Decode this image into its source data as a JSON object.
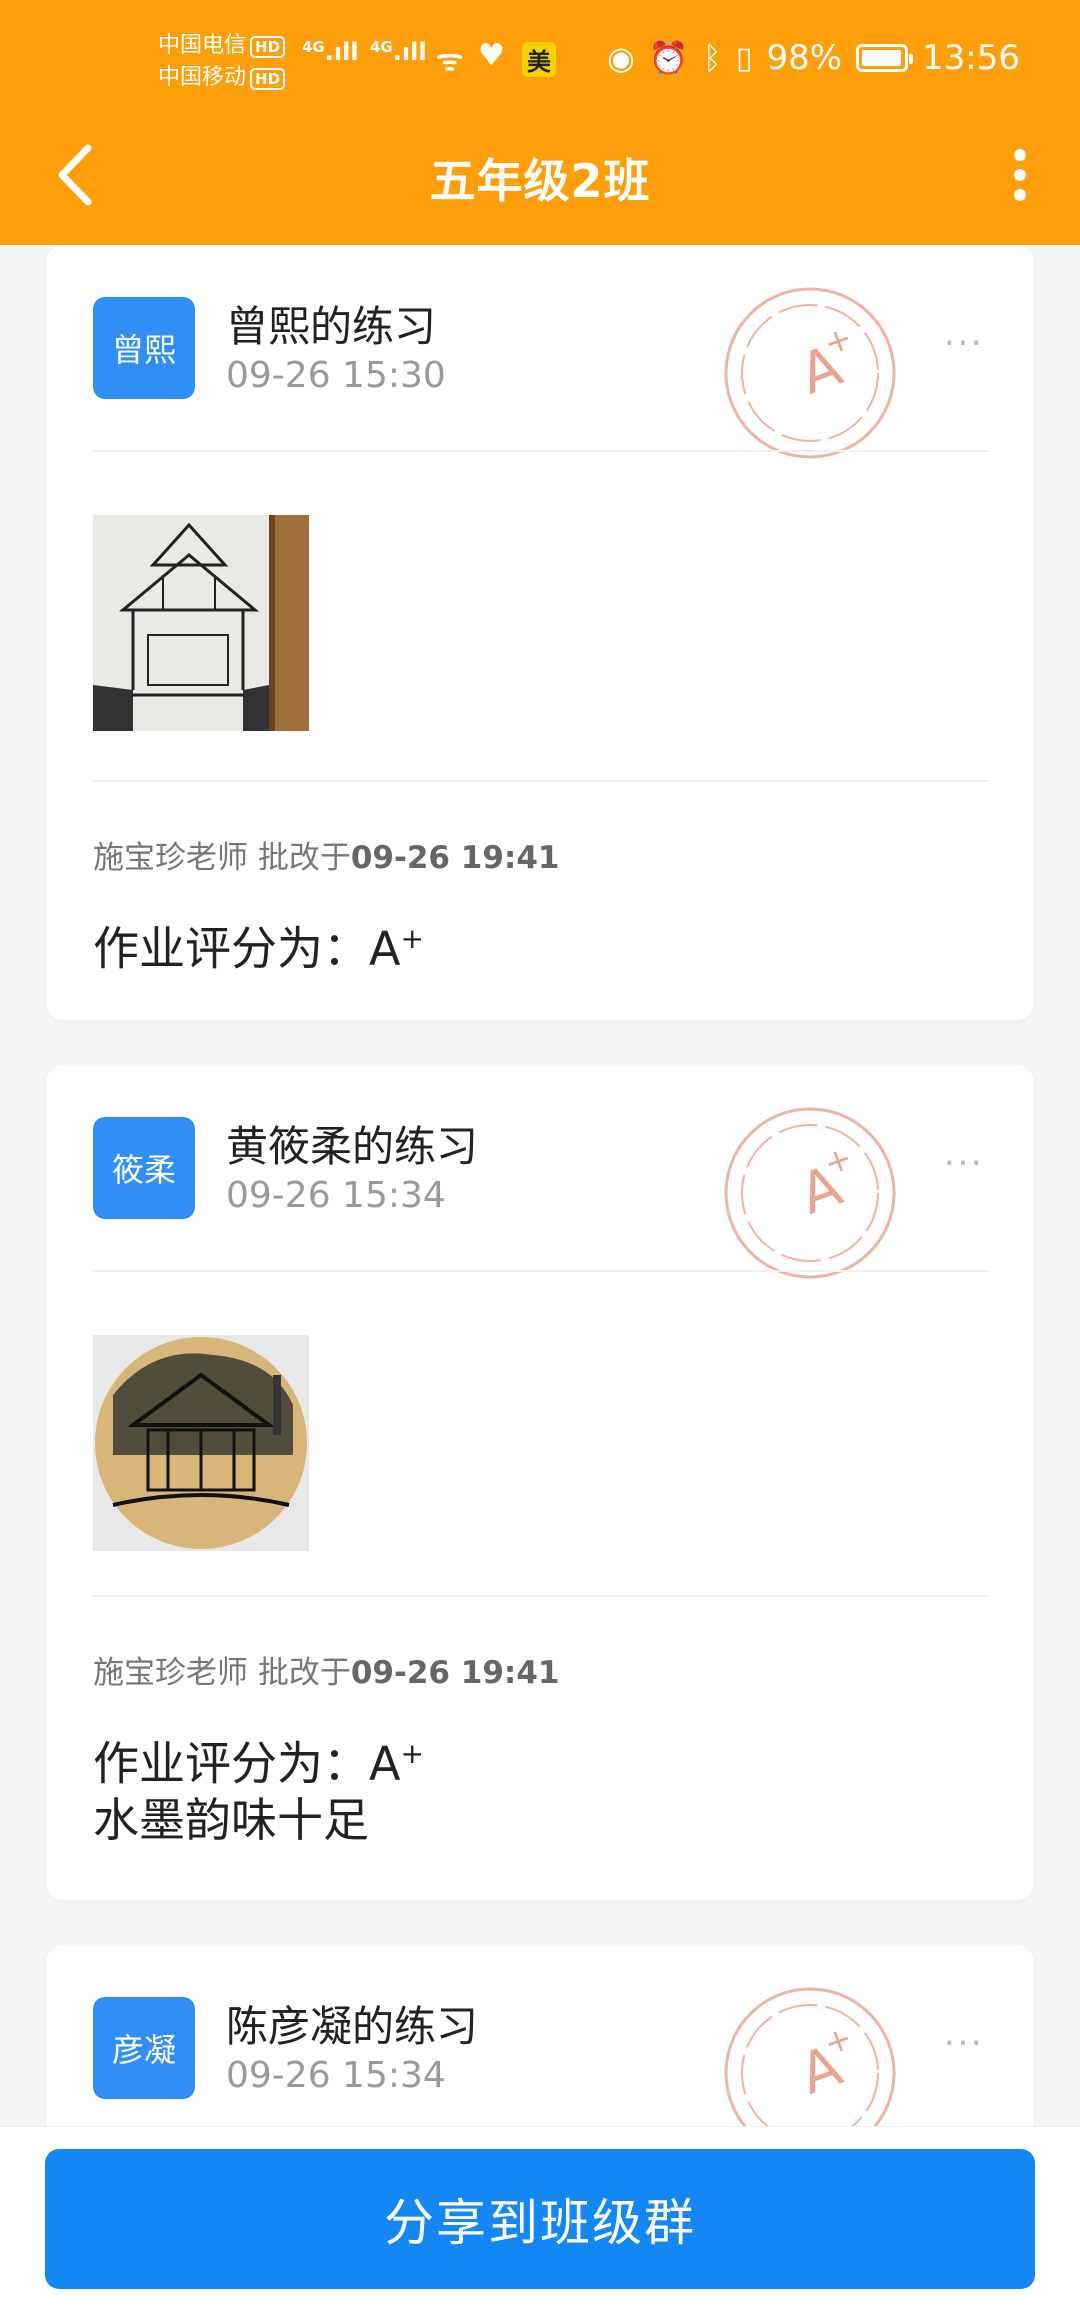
{
  "status": {
    "carrier1": "中国电信",
    "carrier2": "中国移动",
    "hd": "HD",
    "net": "4G",
    "app_badge": "美",
    "battery_text": "98%",
    "battery_level": 0.98,
    "time": "13:56"
  },
  "header": {
    "title": "五年级2班"
  },
  "cards": [
    {
      "avatar": "曾熙",
      "name": "曾熙的练习",
      "time": "09-26 15:30",
      "teacher": "施宝珍老师 批改于",
      "graded_time": "09-26 19:41",
      "score_label": "作业评分为：",
      "score": "A",
      "score_sup": "+",
      "comment": ""
    },
    {
      "avatar": "筱柔",
      "name": "黄筱柔的练习",
      "time": "09-26 15:34",
      "teacher": "施宝珍老师 批改于",
      "graded_time": "09-26 19:41",
      "score_label": "作业评分为：",
      "score": "A",
      "score_sup": "+",
      "comment": "水墨韵味十足"
    },
    {
      "avatar": "彦凝",
      "name": "陈彦凝的练习",
      "time": "09-26 15:34"
    }
  ],
  "more_label": "···",
  "share_button": "分享到班级群",
  "colors": {
    "header": "#fe9e0b",
    "avatar": "#2f8ff5",
    "button": "#1388f5",
    "stamp": "#e9a48f"
  }
}
